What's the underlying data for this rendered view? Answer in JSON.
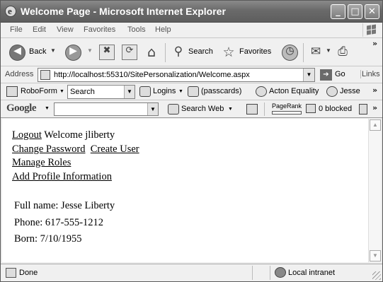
{
  "window": {
    "title": "Welcome Page - Microsoft Internet Explorer",
    "minimize": "_",
    "maximize": "□",
    "close": "✕"
  },
  "menu": [
    "File",
    "Edit",
    "View",
    "Favorites",
    "Tools",
    "Help"
  ],
  "toolbar": {
    "back_label": "Back",
    "search_label": "Search",
    "favorites_label": "Favorites",
    "more_chevron": "»"
  },
  "address": {
    "label": "Address",
    "url": "http://localhost:55310/SitePersonalization/Welcome.aspx",
    "go_label": "Go",
    "links_label": "Links"
  },
  "roboform": {
    "name": "RoboForm",
    "search_value": "Search",
    "logins": "Logins",
    "passcards": "(passcards)",
    "item1": "Acton Equality",
    "item2": "Jesse",
    "more_chevron": "»"
  },
  "google": {
    "logo": "Google",
    "search_web": "Search Web",
    "pagerank": "PageRank",
    "blocked": "0 blocked",
    "more_chevron": "»"
  },
  "page": {
    "logout": "Logout",
    "welcome_text": " Welcome jliberty",
    "change_password": "Change Password",
    "create_user": "Create User",
    "manage_roles": "Manage Roles",
    "add_profile": "Add Profile Information",
    "full_name": "Full name: Jesse Liberty",
    "phone": "Phone: 617-555-1212",
    "born": "Born: 7/10/1955"
  },
  "status": {
    "text": "Done",
    "zone": "Local intranet"
  },
  "icons": {
    "back": "back-arrow-icon",
    "forward": "forward-arrow-icon",
    "stop": "stop-icon",
    "refresh": "refresh-icon",
    "home": "home-icon",
    "search": "search-icon",
    "favorites": "favorites-star-icon",
    "history": "history-icon",
    "mail": "mail-icon",
    "print": "print-icon"
  }
}
